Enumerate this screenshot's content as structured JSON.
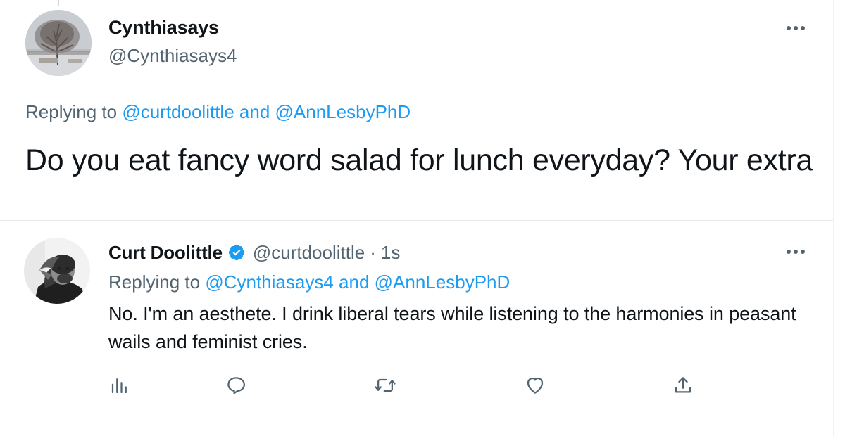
{
  "main_tweet": {
    "display_name": "Cynthiasays",
    "handle": "@Cynthiasays4",
    "replying_prefix": "Replying to",
    "replying_user_1": "@curtdoolittle",
    "replying_and": "and",
    "replying_user_2": "@AnnLesbyPhD",
    "text": "Do you eat fancy word salad for lunch everyday? Your extra"
  },
  "reply_tweet": {
    "display_name": "Curt Doolittle",
    "verified": true,
    "handle": "@curtdoolittle",
    "separator": "·",
    "time": "1s",
    "replying_prefix": "Replying to",
    "replying_user_1": "@Cynthiasays4",
    "replying_and": "and",
    "replying_user_2": "@AnnLesbyPhD",
    "text": "No. I'm an aesthete. I drink liberal tears while listening to the harmonies in peasant wails and feminist cries."
  },
  "actions": [
    {
      "name": "views",
      "icon": "bar-chart-icon"
    },
    {
      "name": "reply",
      "icon": "speech-bubble-icon"
    },
    {
      "name": "retweet",
      "icon": "retweet-icon"
    },
    {
      "name": "like",
      "icon": "heart-icon"
    },
    {
      "name": "share",
      "icon": "share-icon"
    }
  ],
  "colors": {
    "text": "#0f1419",
    "secondary": "#536471",
    "link": "#1d9bf0",
    "divider": "#e7ebee"
  }
}
